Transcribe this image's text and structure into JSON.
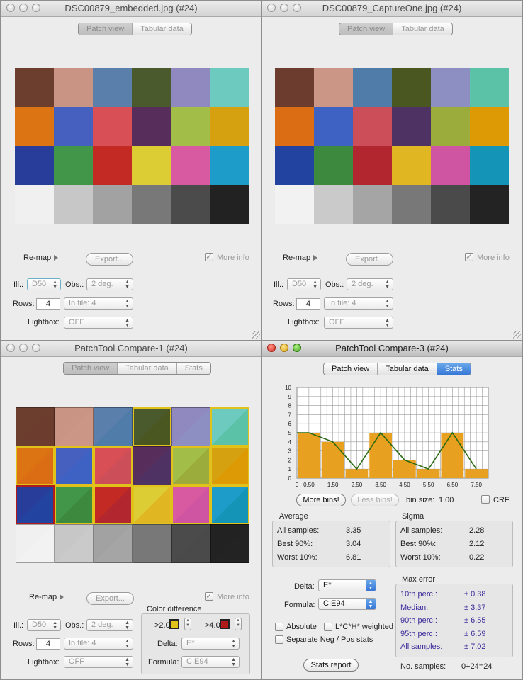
{
  "windows": {
    "w1": {
      "title": "DSC00879_embedded.jpg (#24)",
      "tabs": [
        "Patch view",
        "Tabular data"
      ]
    },
    "w2": {
      "title": "DSC00879_CaptureOne.jpg (#24)",
      "tabs": [
        "Patch view",
        "Tabular data"
      ]
    },
    "w3": {
      "title": "PatchTool Compare-1 (#24)",
      "tabs": [
        "Patch view",
        "Tabular data",
        "Stats"
      ]
    },
    "w4": {
      "title": "PatchTool Compare-3 (#24)",
      "tabs": [
        "Patch view",
        "Tabular data",
        "Stats"
      ]
    }
  },
  "controls": {
    "remap": "Re-map",
    "export": "Export...",
    "more_info": "More info",
    "ill_label": "Ill.:",
    "ill_value": "D50",
    "obs_label": "Obs.:",
    "obs_value": "2 deg.",
    "rows_label": "Rows:",
    "rows_value": "4",
    "infile_value": "In file: 4",
    "lightbox_label": "Lightbox:",
    "lightbox_value": "OFF",
    "check": "✓"
  },
  "color_difference": {
    "title": "Color difference",
    "over2": ">2.0",
    "over4": ">4.0",
    "delta_label": "Delta:",
    "delta_value": "E*",
    "formula_label": "Formula:",
    "formula_value": "CIE94",
    "over2_color": "#e0c21a",
    "over4_color": "#b01a1a"
  },
  "stats": {
    "more_bins": "More bins!",
    "less_bins": "Less bins!",
    "bin_size_label": "bin size:",
    "bin_size": "1.00",
    "crf": "CRF",
    "average_title": "Average",
    "sigma_title": "Sigma",
    "all_samples": "All samples:",
    "best90": "Best 90%:",
    "worst10": "Worst 10%:",
    "avg_all": "3.35",
    "avg_best": "3.04",
    "avg_worst": "6.81",
    "sig_all": "2.28",
    "sig_best": "2.12",
    "sig_worst": "0.22",
    "delta_label": "Delta:",
    "delta_value": "E*",
    "formula_label": "Formula:",
    "formula_value": "CIE94",
    "absolute": "Absolute",
    "lch_weighted": "L*C*H* weighted",
    "separate": "Separate Neg / Pos stats",
    "stats_report": "Stats report",
    "max_error_title": "Max error",
    "p10_label": "10th perc.:",
    "p10": "± 0.38",
    "median_label": "Median:",
    "median": "± 3.37",
    "p90_label": "90th perc.:",
    "p90": "± 6.55",
    "p95_label": "95th perc.:",
    "p95": "± 6.59",
    "allmax_label": "All samples:",
    "allmax": "± 7.02",
    "nsamples_label": "No. samples:",
    "nsamples": "0+24=24"
  },
  "patches_embedded": [
    "#6b3e2e",
    "#c99484",
    "#5b7fab",
    "#4b5a2c",
    "#8f89c0",
    "#6dcabf",
    "#dd7413",
    "#4660c0",
    "#d84f55",
    "#572d5c",
    "#a3be48",
    "#d6a111",
    "#283c9a",
    "#41964a",
    "#c42a24",
    "#ddcd35",
    "#d85aa0",
    "#1d9cca",
    "#f0f0f0",
    "#c7c7c7",
    "#a2a2a2",
    "#787878",
    "#4b4b4b",
    "#222222"
  ],
  "patches_captureone": [
    "#6c3d2e",
    "#cb9686",
    "#4f7ca8",
    "#4b5721",
    "#8d8fc2",
    "#5bc2a8",
    "#db6d14",
    "#3d62c4",
    "#cb4e59",
    "#4d3263",
    "#9bab3c",
    "#dd9a05",
    "#2244a0",
    "#3d8a3f",
    "#b22630",
    "#e0b722",
    "#cf54a2",
    "#1494b6",
    "#f2f2f2",
    "#cacaca",
    "#a5a5a5",
    "#787878",
    "#4a4a4a",
    "#232323"
  ],
  "patch_flags": [
    0,
    0,
    0,
    1,
    0,
    1,
    1,
    1,
    1,
    0,
    1,
    1,
    2,
    1,
    1,
    1,
    1,
    1,
    0,
    0,
    0,
    0,
    0,
    0
  ],
  "chart_data": {
    "type": "bar",
    "x": [
      0.5,
      1.5,
      2.5,
      3.5,
      4.5,
      5.5,
      6.5,
      7.5
    ],
    "values": [
      5,
      4,
      1,
      5,
      2,
      1,
      5,
      1
    ],
    "xticks": [
      "0",
      "0.50",
      "1.50",
      "2.50",
      "3.50",
      "4.50",
      "5.50",
      "6.50",
      "7.50"
    ],
    "yticks": [
      "0",
      "1",
      "2",
      "3",
      "4",
      "5",
      "6",
      "7",
      "8",
      "9",
      "10"
    ],
    "xlim": [
      0,
      8
    ],
    "ylim": [
      0,
      10
    ],
    "grid": true,
    "bar_color": "#e8a020",
    "line_color": "#2a6a10"
  }
}
